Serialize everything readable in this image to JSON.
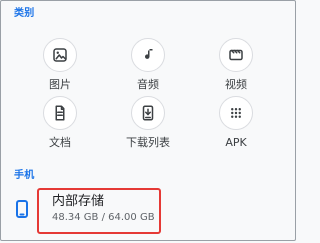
{
  "sections": {
    "category_title": "类别",
    "phone_title": "手机"
  },
  "categories": [
    {
      "label": "图片",
      "icon": "image-icon"
    },
    {
      "label": "音频",
      "icon": "music-note-icon"
    },
    {
      "label": "视频",
      "icon": "video-icon"
    },
    {
      "label": "文档",
      "icon": "document-icon"
    },
    {
      "label": "下载列表",
      "icon": "download-list-icon"
    },
    {
      "label": "APK",
      "icon": "app-grid-icon"
    }
  ],
  "storage": {
    "title": "内部存储",
    "usage": "48.34 GB / 64.00 GB",
    "icon": "phone-icon",
    "highlight_color": "#e53935"
  },
  "colors": {
    "accent": "#1a73e8",
    "icon_circle_bg": "#ffffff",
    "icon_circle_border": "#dadce0"
  }
}
